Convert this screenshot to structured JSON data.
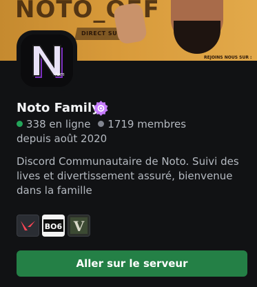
{
  "banner": {
    "title": "NOTO_OFF",
    "subtitle": "DIRECT SUR",
    "join_text": "REJOINS NOUS SUR :"
  },
  "server": {
    "name": "Noto Family",
    "online_count": "338 en ligne",
    "member_count": "1719 membres",
    "since": "depuis août 2020",
    "description": "Discord Communautaire de Noto. Suivi des lives et divertissement assuré, bienvenue dans la famille",
    "avatar_letter": "N"
  },
  "games": [
    {
      "icon": "valorant-icon",
      "label": ""
    },
    {
      "icon": "bo6-icon",
      "label": "BO6"
    },
    {
      "icon": "gta5-icon",
      "label": "V"
    }
  ],
  "actions": {
    "join_label": "Aller sur le serveur"
  },
  "colors": {
    "online": "#23a55a",
    "members": "#80848e",
    "button": "#248046",
    "badge": "#c77dff"
  }
}
